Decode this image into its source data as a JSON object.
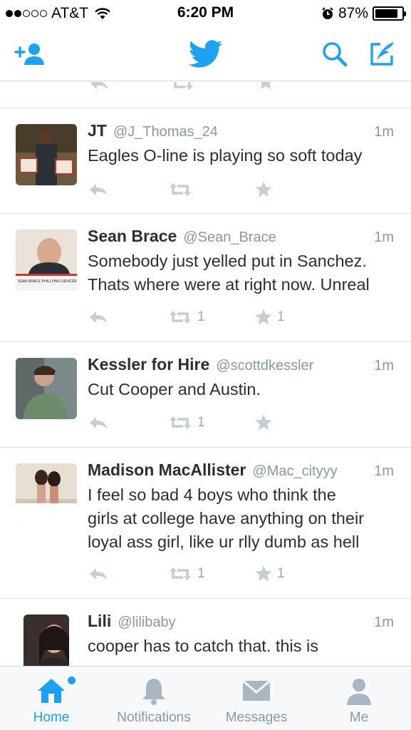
{
  "status_bar": {
    "carrier": "AT&T",
    "time": "6:20 PM",
    "battery": "87%",
    "battery_level": 0.87,
    "signal_bars_filled": 2
  },
  "nav": {
    "icons": [
      "add-user-icon",
      "twitter-bird-icon",
      "search-icon",
      "compose-icon"
    ]
  },
  "colors": {
    "accent": "#1da1f2",
    "muted": "#8899a6",
    "icon_gray": "#c4ced6",
    "text": "#292f33"
  },
  "tweets": [
    {
      "name": "JT",
      "handle": "@J_Thomas_24",
      "time": "1m",
      "lines": [
        "Eagles O-line is playing so soft today"
      ],
      "retweets": "",
      "favorites": ""
    },
    {
      "name": "Sean Brace",
      "handle": "@Sean_Brace",
      "time": "1m",
      "lines": [
        "Somebody just yelled put in Sanchez.",
        "Thats where were at right now. Unreal"
      ],
      "retweets": "1",
      "favorites": "1",
      "avatar_caption": "SEAN BRACE PHILLYINFLUENCER.COM"
    },
    {
      "name": "Kessler for Hire",
      "handle": "@scottdkessler",
      "time": "1m",
      "lines": [
        "Cut Cooper and Austin."
      ],
      "retweets": "1",
      "favorites": ""
    },
    {
      "name": "Madison MacAllister",
      "handle": "@Mac_cityyy",
      "time": "1m",
      "lines": [
        "I feel so bad 4 boys who think the",
        "girls at college have anything on their",
        "loyal ass girl, like ur rlly dumb as hell"
      ],
      "retweets": "1",
      "favorites": "1"
    },
    {
      "name": "Lili",
      "handle": "@lilibaby",
      "time": "1m",
      "lines": [
        "cooper has to catch that. this is"
      ],
      "retweets": "",
      "favorites": ""
    }
  ],
  "tabs": [
    {
      "label": "Home",
      "icon": "home-icon",
      "active": true
    },
    {
      "label": "Notifications",
      "icon": "bell-icon",
      "active": false
    },
    {
      "label": "Messages",
      "icon": "envelope-icon",
      "active": false
    },
    {
      "label": "Me",
      "icon": "person-icon",
      "active": false
    }
  ]
}
